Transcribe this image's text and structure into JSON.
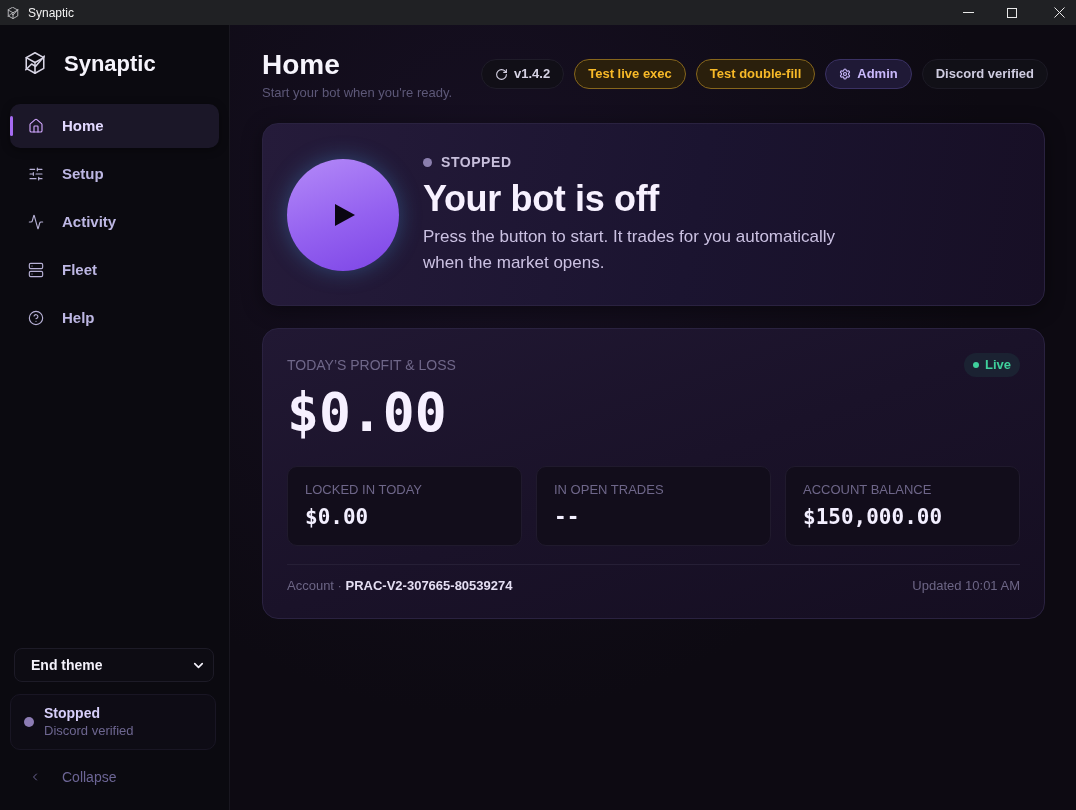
{
  "window": {
    "title": "Synaptic"
  },
  "sidebar": {
    "brand": "Synaptic",
    "nav": [
      {
        "label": "Home",
        "selected": true
      },
      {
        "label": "Setup",
        "selected": false
      },
      {
        "label": "Activity",
        "selected": false
      },
      {
        "label": "Fleet",
        "selected": false
      },
      {
        "label": "Help",
        "selected": false
      }
    ],
    "theme_select": {
      "value": "End theme"
    },
    "status": {
      "title": "Stopped",
      "detail": "Discord verified"
    },
    "collapse": {
      "label": "Collapse"
    }
  },
  "header": {
    "title": "Home",
    "subtitle": "Start your bot when you're ready.",
    "pills": [
      {
        "label": "v1.4.2",
        "kind": "version"
      },
      {
        "label": "Test live exec",
        "kind": "warning"
      },
      {
        "label": "Test double-fill",
        "kind": "warning"
      },
      {
        "label": "Admin",
        "kind": "admin"
      },
      {
        "label": "Discord verified",
        "kind": "plain"
      }
    ]
  },
  "hero": {
    "status": "STOPPED",
    "title": "Your bot is off",
    "description": "Press the button to start. It trades for you automatically when the market opens."
  },
  "pnl": {
    "label": "TODAY’S PROFIT & LOSS",
    "badge": "Live",
    "amount": "$0.00",
    "stats": [
      {
        "label": "LOCKED IN TODAY",
        "value": "$0.00"
      },
      {
        "label": "IN OPEN TRADES",
        "value": "--"
      },
      {
        "label": "ACCOUNT BALANCE",
        "value": "$150,000.00"
      }
    ],
    "account": "Account · **PRAC-V2-307665-80539274**",
    "updated": "Updated 10:01 AM"
  }
}
